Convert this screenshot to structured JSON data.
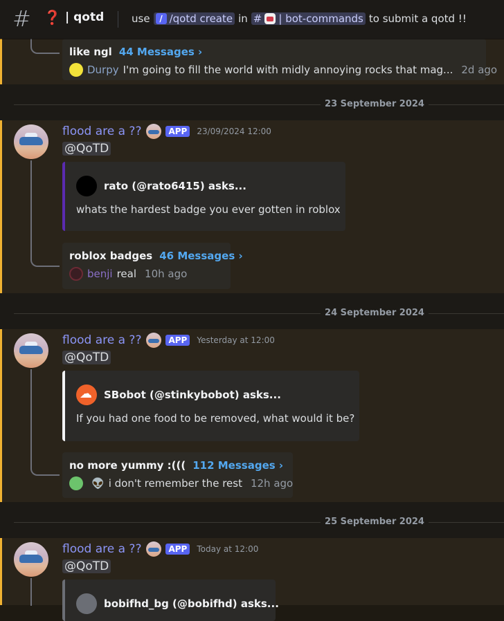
{
  "header": {
    "channel_emoji": "❓",
    "channel_name": "| qotd",
    "topic_use": "use",
    "topic_command": "/qotd create",
    "topic_in": "in",
    "topic_channel_hash": "#",
    "topic_channel": "| bot-commands",
    "topic_suffix": "to submit a qotd !!"
  },
  "top_thread": {
    "title": "like ngl",
    "count": "44 Messages ›",
    "user": "Durpy",
    "user_color": "#8aa3c8",
    "last_message": "I'm going to fill the world with midly annoying rocks that mag...",
    "time": "2d ago"
  },
  "posts": [
    {
      "date": "23 September 2024",
      "author": "flood are a ??",
      "tag": "APP",
      "timestamp": "23/09/2024 12:00",
      "mention": "@QoTD",
      "embed_author": "rato (@rato6415) asks...",
      "embed_question": "whats the hardest badge you ever gotten in roblox",
      "thread_title": "roblox badges",
      "thread_count": "46 Messages ›",
      "thread_user": "benji",
      "thread_user_color": "#8a6fc7",
      "thread_message": "real",
      "thread_time": "10h ago"
    },
    {
      "date": "24 September 2024",
      "author": "flood are a ??",
      "tag": "APP",
      "timestamp": "Yesterday at 12:00",
      "mention": "@QoTD",
      "embed_author": "SBobot (@stinkybobot) asks...",
      "embed_question": "If you had one food to be removed, what would it be?",
      "thread_title": "no more yummy :(((",
      "thread_count": "112 Messages ›",
      "thread_user": "👽",
      "thread_message": "i don't remember the rest",
      "thread_time": "12h ago"
    },
    {
      "date": "25 September 2024",
      "author": "flood are a ??",
      "tag": "APP",
      "timestamp": "Today at 12:00",
      "mention": "@QoTD",
      "embed_author": "bobifhd_bg (@bobifhd) asks..."
    }
  ],
  "colors": {
    "accent_bar": "#f0b232",
    "author": "#8b94f5",
    "link": "#53a8f0"
  }
}
